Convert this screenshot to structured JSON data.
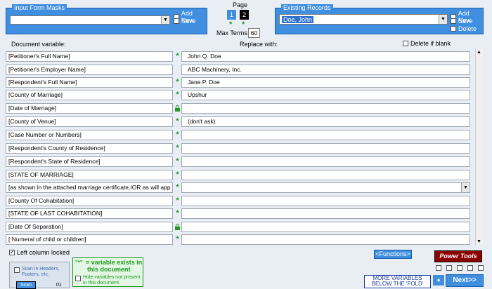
{
  "masks_panel": {
    "title": "Input Form Masks",
    "combo_value": "",
    "add_new": "Add New",
    "save": "Save"
  },
  "page": {
    "label": "Page",
    "buttons": [
      "1",
      "2"
    ],
    "max_terms_label": "Max Terms:",
    "max_terms_value": "60"
  },
  "records_panel": {
    "title": "Existing Records",
    "combo_value": "Doe, John",
    "add_new": "Add New",
    "save": "Save",
    "delete": "Delete"
  },
  "headers": {
    "document_variable": "Document variable:",
    "replace_with": "Replace with:",
    "delete_if_blank": "Delete if blank"
  },
  "rows": [
    {
      "label": "[Petitioner's Full Name]",
      "mark": "*",
      "value": "John Q. Doe"
    },
    {
      "label": "[Petitioner's Employer Name]",
      "mark": "",
      "value": "ABC Machinery, Inc."
    },
    {
      "label": "[Respondent's Full Name]",
      "mark": "*",
      "value": "Jane P. Doe"
    },
    {
      "label": "[County of Marriage]",
      "mark": "*",
      "value": "Upshur"
    },
    {
      "label": "[Date of Marriage]",
      "mark": "lock",
      "value": ""
    },
    {
      "label": "[County of Venue]",
      "mark": "*",
      "value": "(don't ask)"
    },
    {
      "label": "[Case Number or Numbers]",
      "mark": "*",
      "value": ""
    },
    {
      "label": "[Respondent's County of Residence]",
      "mark": "*",
      "value": ""
    },
    {
      "label": "[Respondent's State of Residence]",
      "mark": "*",
      "value": ""
    },
    {
      "label": "[STATE OF MARRIAGE]",
      "mark": "*",
      "value": ""
    },
    {
      "label": "[as shown in the attached marriage certificate./OR as will app",
      "mark": "*",
      "value": "",
      "dropdown": true
    },
    {
      "label": "[County Of Cohabitation]",
      "mark": "*",
      "value": ""
    },
    {
      "label": "[STATE OF LAST COHABITATION]",
      "mark": "*",
      "value": ""
    },
    {
      "label": "[Date Of Separation]",
      "mark": "lock",
      "value": ""
    },
    {
      "label": "[ Numeral of child or children]",
      "mark": "*",
      "value": ""
    }
  ],
  "footer": {
    "left_column_locked": "Left column locked",
    "functions": "<Functions>",
    "power_tools": "Power Tools",
    "legend_star": "\"*\"",
    "legend_line1": "= variable exists in",
    "legend_line2": "this document",
    "hide_vars": "Hide variables not present in this document.",
    "scan_headers": "Scan in Headers, Footers, etc.",
    "scan_btn": "Scan",
    "scan_num": "01",
    "more_vars": "MORE VARIABLES BELOW THE 'FOLD'",
    "next": "Next>>"
  },
  "colors": {
    "accent": "#3f8ee0",
    "green": "#1f9a1f",
    "power_tools": "#8b0000"
  }
}
